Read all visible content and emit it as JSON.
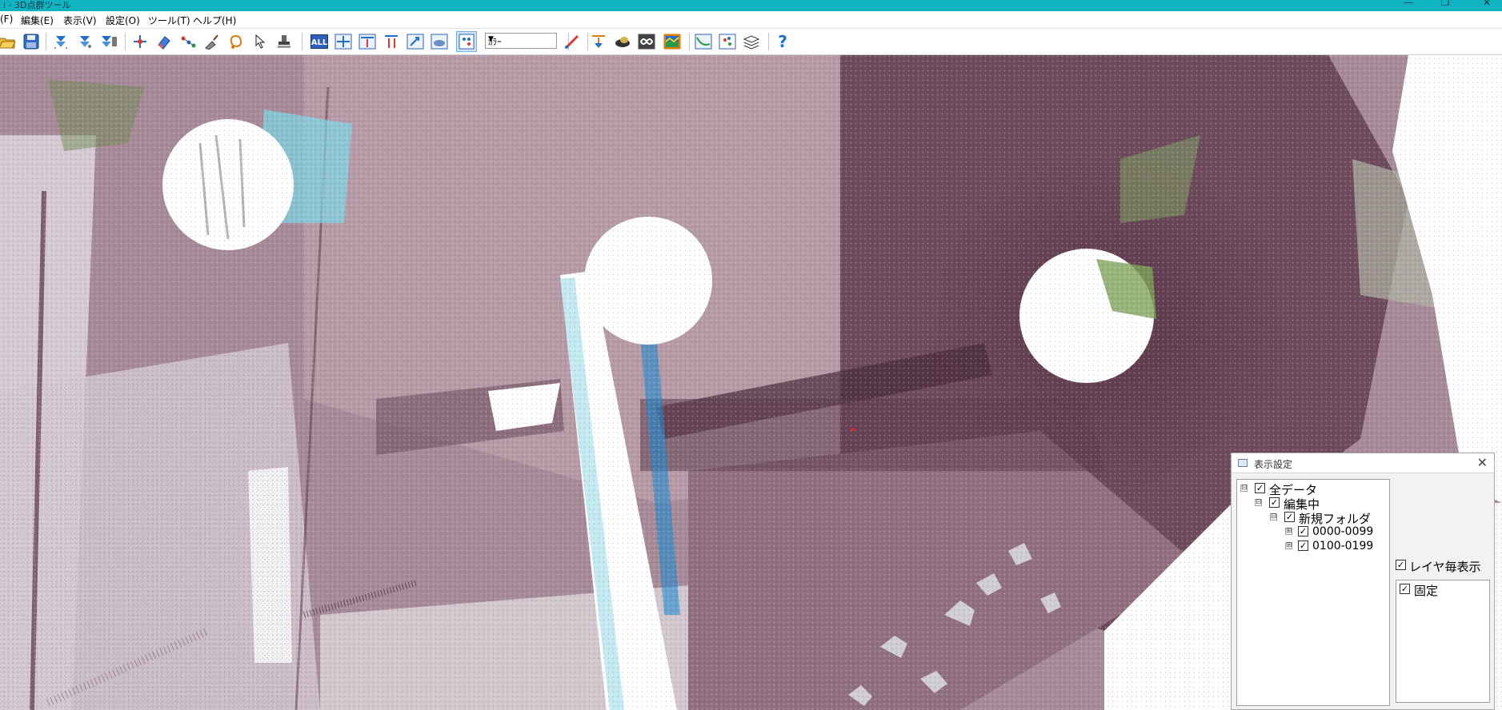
{
  "window": {
    "title": "i - 3D点群ツール",
    "minimize_glyph": "—",
    "maximize_glyph": "❐",
    "close_glyph": "✕"
  },
  "menu": [
    {
      "label": "(F)"
    },
    {
      "label": "編集(E)"
    },
    {
      "label": "表示(V)"
    },
    {
      "label": "設定(O)"
    },
    {
      "label": "ツール(T)"
    },
    {
      "label": "ヘルプ(H)"
    }
  ],
  "toolbar": {
    "icons": [
      "open-folder-icon",
      "save-icon",
      "import-down-icon",
      "import-down-alt-icon",
      "import-filter-icon",
      "edit-points-icon",
      "eraser-icon",
      "measure-points-icon",
      "trowel-icon",
      "lasso-icon",
      "pick-cursor-icon",
      "stamp-icon",
      "select-all-icon",
      "move-icon",
      "align-top-icon",
      "split-icon",
      "zoom-fit-icon",
      "pan-icon",
      "view-grid-icon",
      "drop-icon",
      "cloud-icon",
      "infinity-icon",
      "color-map-icon",
      "section-icon",
      "point-color-icon",
      "layers-icon",
      "help-icon"
    ],
    "select_all_text": "ALL",
    "help_glyph": "?",
    "color_mode": {
      "selected": "ｶﾗｰ"
    }
  },
  "panel": {
    "title": "表示設定",
    "close_glyph": "✕",
    "tree": [
      {
        "label": "全データ",
        "checked": true,
        "expander": "⊟"
      },
      {
        "label": "編集中",
        "checked": true,
        "expander": "⊟"
      },
      {
        "label": "新規フォルダ",
        "checked": true,
        "expander": "⊟"
      },
      {
        "label": "0000-0099",
        "checked": true,
        "expander": "⊞"
      },
      {
        "label": "0100-0199",
        "checked": true,
        "expander": "⊞"
      }
    ],
    "per_layer": {
      "label": "レイヤ毎表示",
      "checked": true
    },
    "layers": [
      {
        "label": "固定",
        "checked": true
      }
    ]
  },
  "colors": {
    "titlebar": "#10b3c2",
    "toolbar_active": "#cde4f7",
    "icon_blue": "#1f6fd1",
    "icon_red": "#d93a2b"
  }
}
